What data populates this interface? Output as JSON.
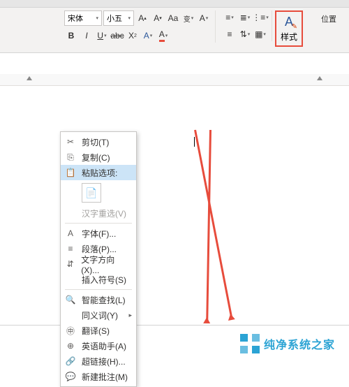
{
  "ribbon": {
    "font_name": "宋体",
    "font_size": "小五",
    "styles_label": "样式",
    "position_label": "位置"
  },
  "context_menu": {
    "cut": "剪切(T)",
    "copy": "复制(C)",
    "paste_options": "粘贴选项:",
    "han_reselect": "汉字重选(V)",
    "font": "字体(F)...",
    "paragraph": "段落(P)...",
    "text_direction": "文字方向(X)...",
    "insert_symbol": "插入符号(S)",
    "smart_lookup": "智能查找(L)",
    "synonyms": "同义词(Y)",
    "translate": "翻译(S)",
    "english_assistant": "英语助手(A)",
    "hyperlink": "超链接(H)...",
    "new_comment": "新建批注(M)"
  },
  "watermark": "纯净系统之家"
}
